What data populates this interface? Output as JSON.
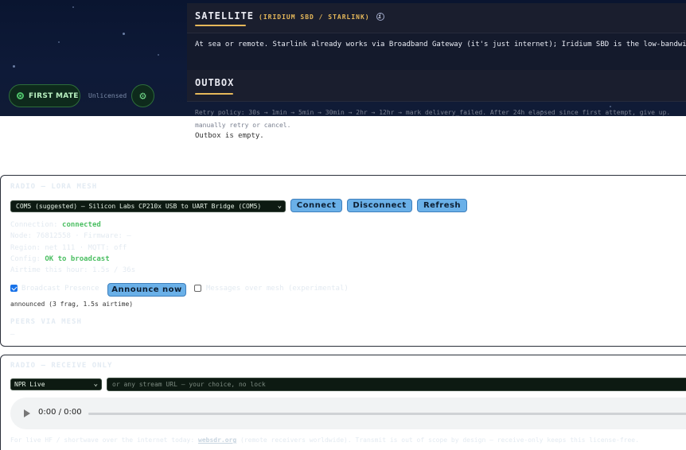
{
  "header": {
    "first_mate_label": "FIRST MATE",
    "license_status": "Unlicensed"
  },
  "satellite": {
    "title": "SATELLITE",
    "subtitle": "(IRIDIUM SBD / STARLINK)",
    "description": "At sea or remote. Starlink already works via Broadband Gateway (it's just internet); Iridium SBD is the low-bandwidth"
  },
  "outbox": {
    "title": "OUTBOX",
    "retry_policy": "Retry policy: 30s → 1min → 5min → 30min → 2hr → 12hr → mark delivery_failed. After 24h elapsed since first attempt, give up. manually retry or cancel.",
    "empty_text": "Outbox is empty."
  },
  "lora": {
    "title": "RADIO — LORA MESH",
    "port_value": "COM5 (suggested) — Silicon Labs CP210x USB to UART Bridge (COM5)",
    "connect_label": "Connect",
    "disconnect_label": "Disconnect",
    "refresh_label": "Refresh",
    "connection_key": "Connection:",
    "connection_value": "connected",
    "node_line": "Node: 76812558 · Firmware: —",
    "region_line": "Region: net 111 · MQTT: off",
    "config_key": "Config:",
    "config_value": "OK to broadcast",
    "airtime_line": "Airtime this hour: 1.5s / 36s",
    "broadcast_label": "Broadcast Presence",
    "announce_label": "Announce now",
    "messages_label": "Messages over mesh (experimental)",
    "announced_text": "announced (3 frag, 1.5s airtime)",
    "peers_title": "PEERS VIA MESH",
    "peers_empty": "—"
  },
  "receive": {
    "title": "RADIO — RECEIVE ONLY",
    "stream_value": "NPR Live",
    "url_placeholder": "or any stream URL — your choice, no lock",
    "time_display": "0:00 / 0:00",
    "footnote_prefix": "For live HF / shortwave over the internet today: ",
    "footnote_link": "websdr.org",
    "footnote_suffix": " (remote receivers worldwide). Transmit is out of scope by design — receive-only keeps this license-free."
  }
}
